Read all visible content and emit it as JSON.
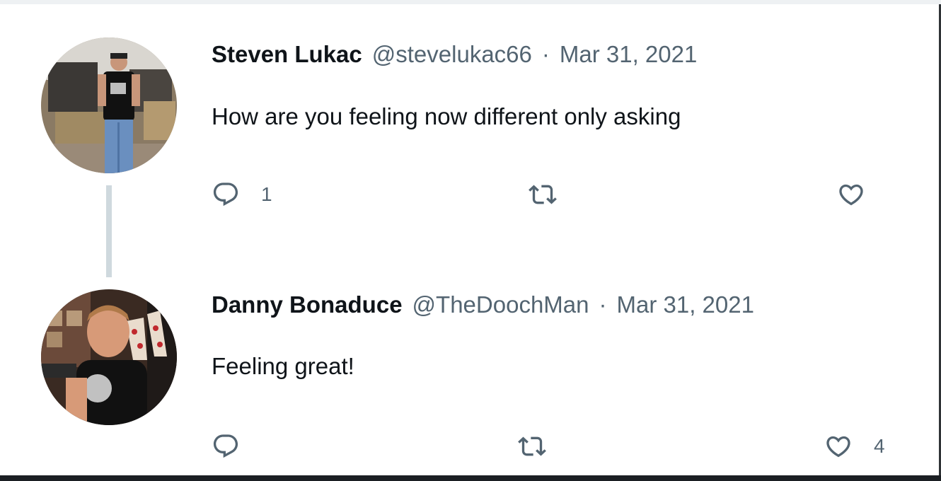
{
  "tweets": [
    {
      "display_name": "Steven Lukac",
      "handle": "@stevelukac66",
      "separator": "·",
      "date": "Mar 31, 2021",
      "text": "How are you feeling now different only asking",
      "reply_count": "1",
      "retweet_count": "",
      "like_count": ""
    },
    {
      "display_name": "Danny Bonaduce",
      "handle": "@TheDoochMan",
      "separator": "·",
      "date": "Mar 31, 2021",
      "text": "Feeling great!",
      "reply_count": "",
      "retweet_count": "",
      "like_count": "4"
    }
  ],
  "icons": {
    "reply": "reply-icon",
    "retweet": "retweet-icon",
    "like": "heart-icon"
  },
  "colors": {
    "primary_text": "#0f1419",
    "secondary_text": "#536471",
    "thread_line": "#cfd9de"
  }
}
